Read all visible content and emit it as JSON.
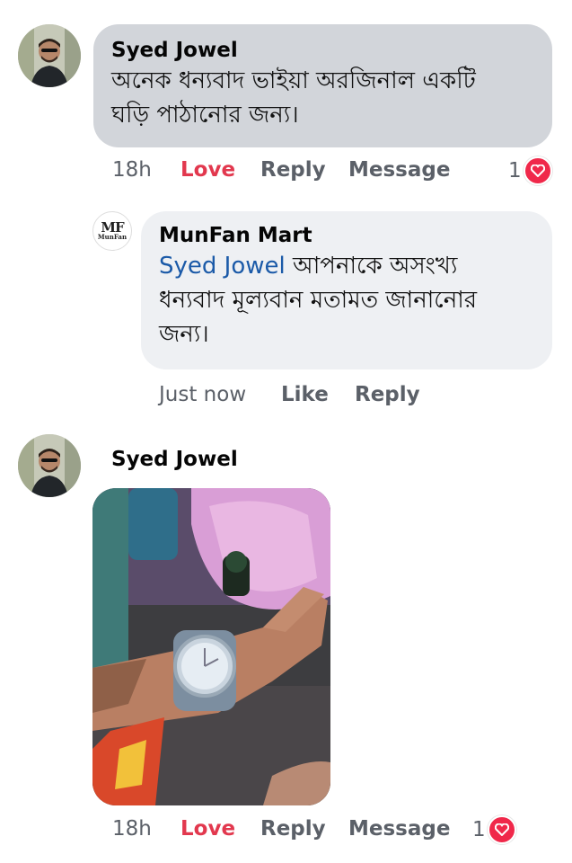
{
  "comments": [
    {
      "author": "Syed Jowel",
      "text_line1": "অনেক ধন্যবাদ ভাইয়া অরজিনাল একটি",
      "text_line2": "ঘড়ি পাঠানোর জন্য।",
      "time": "18h",
      "love": "Love",
      "reply": "Reply",
      "message": "Message",
      "reaction_count": "1"
    },
    {
      "author": "MunFan Mart",
      "mention": "Syed Jowel",
      "text_line1": " আপনাকে অসংখ্য",
      "text_line2": "ধন্যবাদ মূল্যবান মতামত জানানোর",
      "text_line3": "জন্য।",
      "time": "Just now",
      "like": "Like",
      "reply": "Reply",
      "logo_top": "MF",
      "logo_bottom": "MunFan"
    },
    {
      "author": "Syed Jowel",
      "time": "18h",
      "love": "Love",
      "reply": "Reply",
      "message": "Message",
      "reaction_count": "1"
    }
  ],
  "icons": {
    "reaction": "heart-icon",
    "avatar": "user-avatar",
    "page_logo": "munfan-logo"
  },
  "colors": {
    "bubble_dark": "#d2d5da",
    "bubble_light": "#eef0f3",
    "love": "#e2384e",
    "mention": "#1b5aa8",
    "meta": "#5b6068"
  }
}
